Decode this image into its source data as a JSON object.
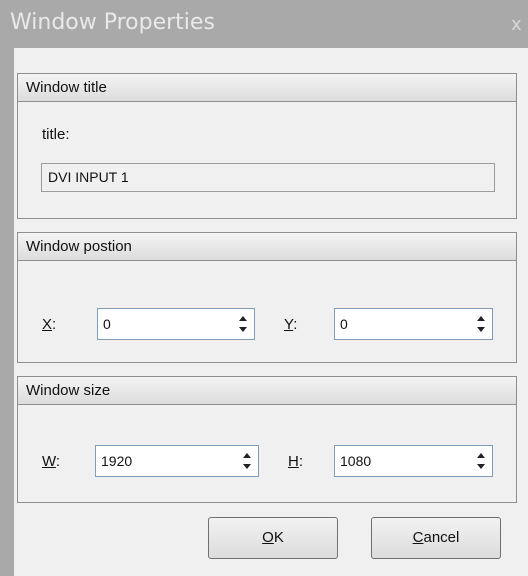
{
  "window": {
    "title": "Window Properties",
    "close_glyph": "x"
  },
  "title_group": {
    "header": "Window title",
    "field_label": "title:",
    "value": "DVI INPUT 1"
  },
  "position_group": {
    "header": "Window postion",
    "x_label_key": "X",
    "x_label_rest": ":",
    "x_value": "0",
    "y_label_key": "Y",
    "y_label_rest": ":",
    "y_value": "0"
  },
  "size_group": {
    "header": "Window size",
    "w_label_key": "W",
    "w_label_rest": ":",
    "w_value": "1920",
    "h_label_key": "H",
    "h_label_rest": ":",
    "h_value": "1080"
  },
  "buttons": {
    "ok_key": "O",
    "ok_rest": "K",
    "cancel_key": "C",
    "cancel_rest": "ancel"
  },
  "icons": {
    "close": "close-icon",
    "spin_up": "spin-up-icon",
    "spin_down": "spin-down-icon"
  }
}
